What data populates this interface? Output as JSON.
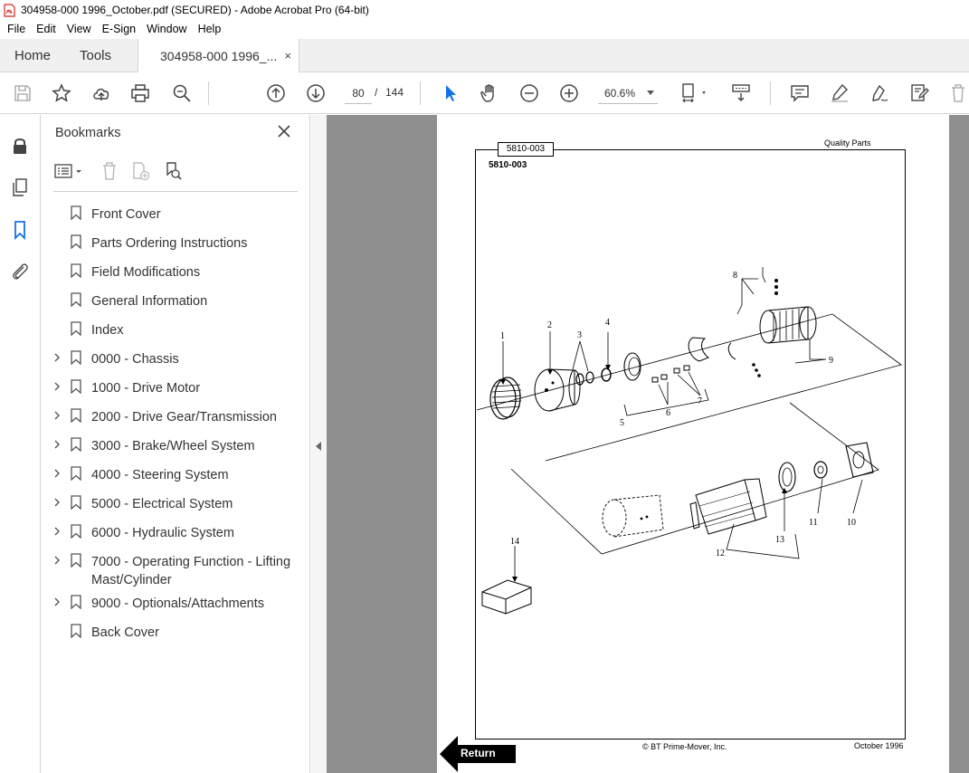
{
  "window": {
    "title": "304958-000 1996_October.pdf (SECURED) - Adobe Acrobat Pro (64-bit)"
  },
  "menu": [
    "File",
    "Edit",
    "View",
    "E-Sign",
    "Window",
    "Help"
  ],
  "tabs": {
    "home": "Home",
    "tools": "Tools",
    "document": "304958-000 1996_...",
    "close": "×"
  },
  "toolbar": {
    "current_page": "80",
    "page_separator": "/",
    "total_pages": "144",
    "zoom": "60.6%"
  },
  "bookmarks": {
    "title": "Bookmarks",
    "items": [
      {
        "label": "Front Cover",
        "expandable": false
      },
      {
        "label": "Parts Ordering Instructions",
        "expandable": false
      },
      {
        "label": "Field Modifications",
        "expandable": false
      },
      {
        "label": "General Information",
        "expandable": false
      },
      {
        "label": "Index",
        "expandable": false
      },
      {
        "label": "0000 - Chassis",
        "expandable": true
      },
      {
        "label": "1000 - Drive Motor",
        "expandable": true
      },
      {
        "label": "2000 - Drive Gear/Transmission",
        "expandable": true
      },
      {
        "label": "3000 - Brake/Wheel System",
        "expandable": true
      },
      {
        "label": "4000 - Steering System",
        "expandable": true
      },
      {
        "label": "5000 - Electrical System",
        "expandable": true
      },
      {
        "label": "6000 - Hydraulic System",
        "expandable": true
      },
      {
        "label": "7000 - Operating Function - Lifting Mast/Cylinder",
        "expandable": true
      },
      {
        "label": "9000 - Optionals/Attachments",
        "expandable": true
      },
      {
        "label": "Back Cover",
        "expandable": false
      }
    ]
  },
  "document_page": {
    "tab_label": "5810-003",
    "sub_label": "5810-003",
    "header_right": "Quality Parts",
    "footer_copyright": "© BT Prime-Mover, Inc.",
    "footer_date": "October 1996",
    "return_label": "Return",
    "callouts": [
      "1",
      "2",
      "3",
      "4",
      "5",
      "6",
      "7",
      "8",
      "9",
      "10",
      "11",
      "12",
      "13",
      "14"
    ]
  },
  "colors": {
    "accent_blue": "#1473e6",
    "doc_background": "#8f8f8f",
    "pdf_red": "#d7261e"
  }
}
